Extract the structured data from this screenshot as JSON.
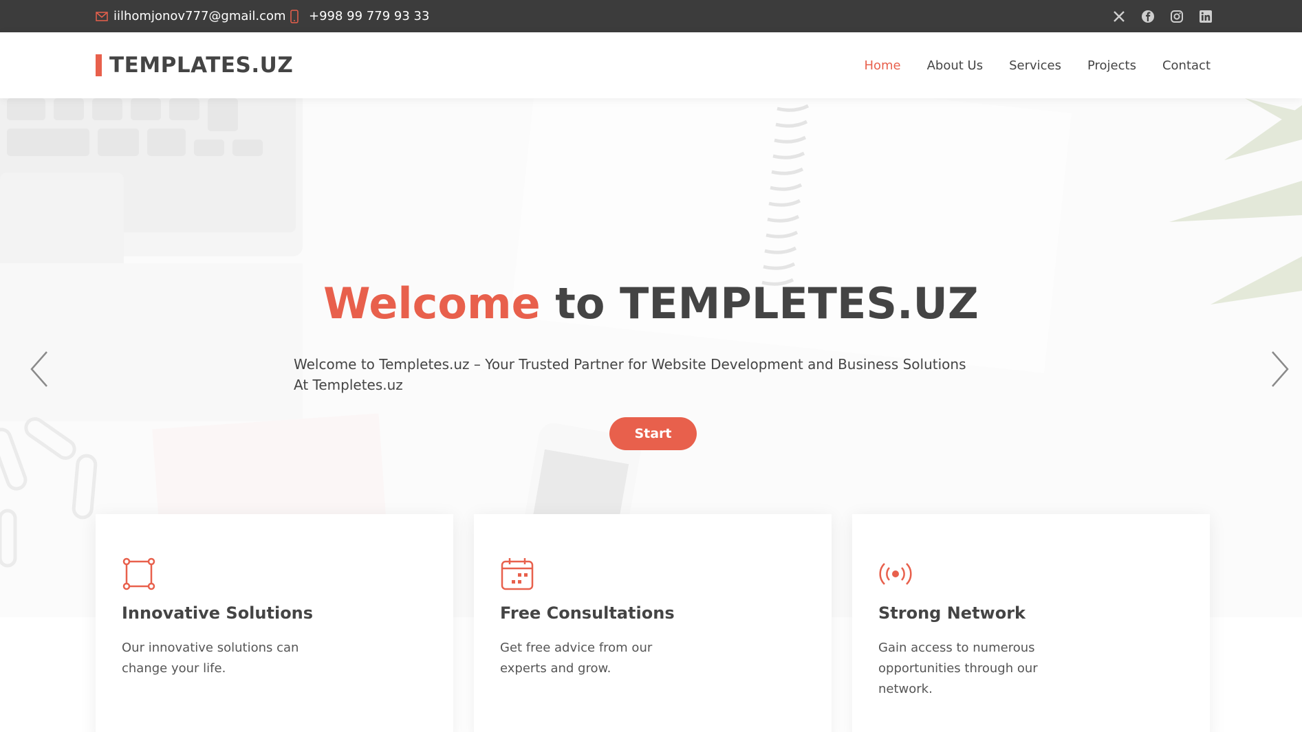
{
  "topbar": {
    "email": "iilhomjonov777@gmail.com",
    "phone": "+998 99 779 93 33",
    "email_icon": "mail-icon",
    "phone_icon": "phone-icon",
    "socials": [
      "x-icon",
      "facebook-icon",
      "instagram-icon",
      "linkedin-icon"
    ]
  },
  "header": {
    "logo": "TEMPLATES.UZ",
    "nav": [
      {
        "label": "Home",
        "active": true
      },
      {
        "label": "About Us",
        "active": false
      },
      {
        "label": "Services",
        "active": false
      },
      {
        "label": "Projects",
        "active": false
      },
      {
        "label": "Contact",
        "active": false
      }
    ]
  },
  "hero": {
    "title_accent": "Welcome",
    "title_rest": "to TEMPLETES.UZ",
    "subtitle": "Welcome to Templetes.uz – Your Trusted Partner for Website Development and Business Solutions At Templetes.uz",
    "button": "Start"
  },
  "cards": [
    {
      "icon": "frame-icon",
      "title": "Innovative Solutions",
      "text": "Our innovative solutions can change your life."
    },
    {
      "icon": "calendar-icon",
      "title": "Free Consultations",
      "text": "Get free advice from our experts and grow."
    },
    {
      "icon": "broadcast-icon",
      "title": "Strong Network",
      "text": "Gain access to numerous opportunities through our network."
    }
  ],
  "colors": {
    "accent": "#e8604c",
    "topbar": "#3c3c3c",
    "text": "#444444"
  }
}
